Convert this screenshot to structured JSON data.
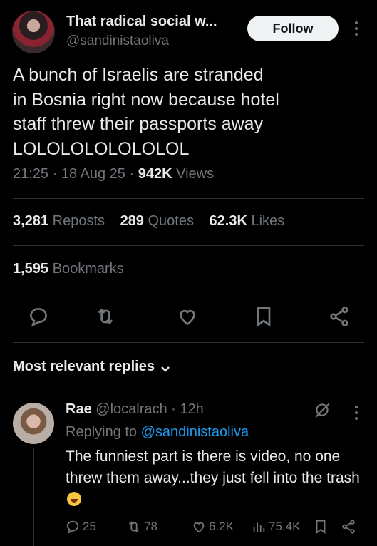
{
  "author": {
    "name": "That radical social w...",
    "handle": "@sandinistaoliva",
    "follow_label": "Follow"
  },
  "tweet": {
    "text": "A bunch of Israelis are stranded\nin Bosnia right now because hotel\nstaff threw their passports away\nLOLOLOLOLOLOLOL",
    "time": "21:25",
    "date": "18 Aug 25",
    "views_count": "942K",
    "views_label": "Views",
    "reposts_count": "3,281",
    "reposts_label": "Reposts",
    "quotes_count": "289",
    "quotes_label": "Quotes",
    "likes_count": "62.3K",
    "likes_label": "Likes",
    "bookmarks_count": "1,595",
    "bookmarks_label": "Bookmarks"
  },
  "icons": [
    "reply-icon",
    "repost-icon",
    "like-icon",
    "bookmark-icon",
    "share-icon",
    "grok-icon",
    "chevron-down-icon",
    "views-icon"
  ],
  "replies_header": {
    "label": "Most relevant replies"
  },
  "reply": {
    "name": "Rae",
    "handle": "@localrach",
    "time": "12h",
    "replying_prefix": "Replying to",
    "replying_to": "@sandinistaoliva",
    "text": "The funniest part is there is video, no one threw them away...they just fell into the trash",
    "replies": "25",
    "reposts": "78",
    "likes": "6.2K",
    "views": "75.4K"
  },
  "colors": {
    "background": "#000000",
    "text_primary": "#e7e9ea",
    "text_secondary": "#71767b",
    "link": "#1d9bf0",
    "divider": "#2f3336",
    "follow_bg": "#eff3f4"
  }
}
